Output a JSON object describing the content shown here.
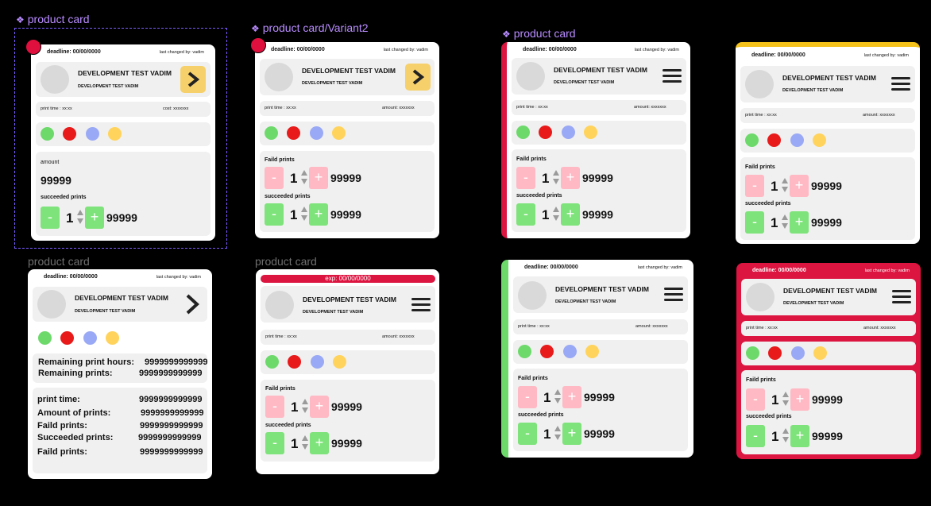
{
  "labels": {
    "f1": "product card",
    "f2": "product card/Variant2",
    "f3": "product card",
    "f4": "product card",
    "f5": "product card"
  },
  "card": {
    "deadline": "deadline: 00/00/0000",
    "last_changed": "last changed by: vadim",
    "title": "DEVELOPMENT TEST VADIM",
    "subtitle": "DEVELOPMENT TEST VADIM",
    "print_time": "print time : xx:xx",
    "cost": "cost: xxxxxxx",
    "amount_small": "amount: xxxxxxx",
    "amount_label": "amount",
    "amount_value": "99999",
    "succeeded_label": "succeeded prints",
    "failed_label": "Faild prints",
    "stepper_value": "1",
    "stepper_count": "99999",
    "minus": "-",
    "plus": "+",
    "exp": "exp: 00/00/0000"
  },
  "details": {
    "remaining_hours_label": "Remaining print hours:",
    "remaining_hours_value": "9999999999999",
    "remaining_prints_label": "Remaining prints:",
    "remaining_prints_value": "9999999999999",
    "print_time_label": "print time:",
    "print_time_value": "9999999999999",
    "amount_label": "Amount of prints:",
    "amount_value": "9999999999999",
    "faild_label": "Faild prints:",
    "faild_value": "9999999999999",
    "succeeded_label": "Succeeded prints:",
    "succeeded_value": "9999999999999",
    "faild2_label": "Faild prints:",
    "faild2_value": "9999999999999"
  },
  "colors": {
    "dot1": "#6dd96b",
    "dot2": "#e81a1a",
    "dot3": "#9aa9f5",
    "dot4": "#ffd35c",
    "red_accent": "#dc1440",
    "green_accent": "#6dd96b",
    "yellow_accent": "#f4c21b"
  }
}
